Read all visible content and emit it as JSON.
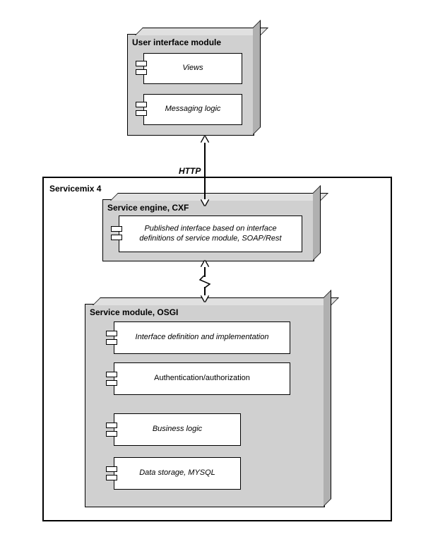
{
  "ui_module": {
    "title": "User interface module",
    "views": "Views",
    "messaging": "Messaging logic"
  },
  "servicemix": {
    "title": "Servicemix 4"
  },
  "service_engine": {
    "title": "Service engine, CXF",
    "published": "Published interface based on interface definitions of service module, SOAP/Rest"
  },
  "service_module": {
    "title": "Service module, OSGI",
    "interface_def": "Interface definition and implementation",
    "auth": "Authentication/authorization",
    "business": "Business logic",
    "data_storage": "Data storage, MYSQL"
  },
  "connectors": {
    "http": "HTTP"
  }
}
